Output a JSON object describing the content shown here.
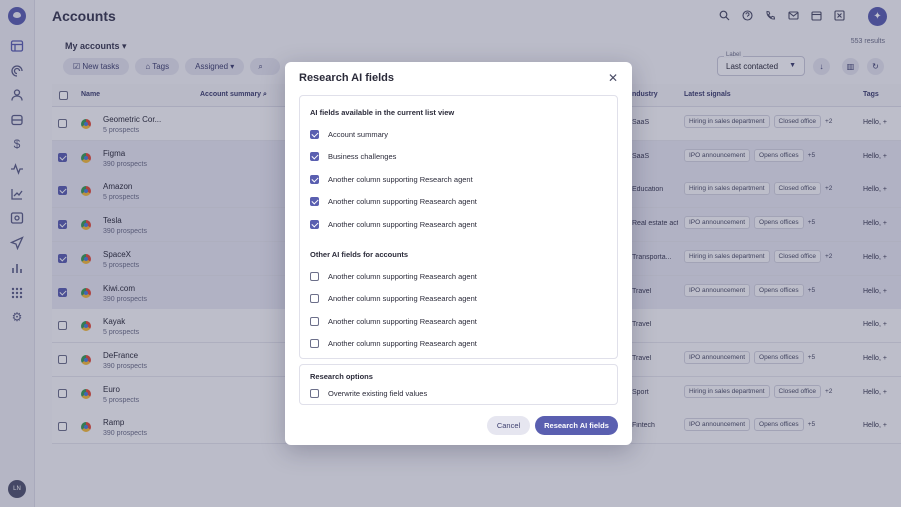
{
  "app": {
    "title": "Accounts",
    "avatar_initials": "LN",
    "results": "553 results"
  },
  "list": {
    "title": "My accounts"
  },
  "toolbar": {
    "new_tasks": "New tasks",
    "tags": "Tags",
    "assigned": "Assigned"
  },
  "label_filter": {
    "legend": "Label",
    "value": "Last contacted"
  },
  "table": {
    "headers": {
      "name": "Name",
      "account_summary": "Account summary",
      "industry": "Industry",
      "latest_signals": "Latest signals",
      "tags": "Tags"
    },
    "rows": [
      {
        "name": "Geometric Cor...",
        "prospects": "5 prospects",
        "selected": false,
        "industry": "SaaS",
        "signals": [
          "Hiring in sales department",
          "Closed office"
        ],
        "more": "+2",
        "tags": "Hello, +"
      },
      {
        "name": "Figma",
        "prospects": "390 prospects",
        "selected": true,
        "industry": "SaaS",
        "signals": [
          "IPO announcement",
          "Opens offices"
        ],
        "more": "+5",
        "tags": "Hello, +"
      },
      {
        "name": "Amazon",
        "prospects": "5 prospects",
        "selected": true,
        "industry": "Education",
        "signals": [
          "Hiring in sales department",
          "Closed office"
        ],
        "more": "+2",
        "tags": "Hello, +"
      },
      {
        "name": "Tesla",
        "prospects": "390 prospects",
        "selected": true,
        "industry": "Real estate activities",
        "signals": [
          "IPO announcement",
          "Opens offices"
        ],
        "more": "+5",
        "tags": "Hello, +"
      },
      {
        "name": "SpaceX",
        "prospects": "5 prospects",
        "selected": true,
        "industry": "Transporta...",
        "signals": [
          "Hiring in sales department",
          "Closed office"
        ],
        "more": "+2",
        "tags": "Hello, +"
      },
      {
        "name": "Kiwi.com",
        "prospects": "390 prospects",
        "selected": true,
        "industry": "Travel",
        "signals": [
          "IPO announcement",
          "Opens offices"
        ],
        "more": "+5",
        "tags": "Hello, +"
      },
      {
        "name": "Kayak",
        "prospects": "5 prospects",
        "selected": false,
        "industry": "Travel",
        "signals": [],
        "more": "",
        "tags": "Hello, +"
      },
      {
        "name": "DeFrance",
        "prospects": "390 prospects",
        "selected": false,
        "industry": "Travel",
        "signals": [
          "IPO announcement",
          "Opens offices"
        ],
        "more": "+5",
        "tags": "Hello, +"
      },
      {
        "name": "Euro",
        "prospects": "5 prospects",
        "selected": false,
        "industry": "Sport",
        "signals": [
          "Hiring in sales department",
          "Closed office"
        ],
        "more": "+2",
        "tags": "Hello, +"
      },
      {
        "name": "Ramp",
        "prospects": "390 prospects",
        "selected": false,
        "industry": "Fintech",
        "signals": [
          "IPO announcement",
          "Opens offices"
        ],
        "more": "+5",
        "tags": "Hello, +"
      }
    ]
  },
  "modal": {
    "title": "Research AI fields",
    "section_current": "AI fields available in the current list view",
    "current_fields": [
      {
        "label": "Account summary",
        "checked": true
      },
      {
        "label": "Business challenges",
        "checked": true
      },
      {
        "label": "Another column supporting Research agent",
        "checked": true
      },
      {
        "label": "Another column supporting Reasearch agent",
        "checked": true
      },
      {
        "label": "Another column supporting Reasearch agent",
        "checked": true
      }
    ],
    "section_other": "Other AI fields for accounts",
    "other_fields": [
      {
        "label": "Another column supporting Reasearch agent",
        "checked": false
      },
      {
        "label": "Another column supporting Reasearch agent",
        "checked": false
      },
      {
        "label": "Another column supporting Reasearch agent",
        "checked": false
      },
      {
        "label": "Another column supporting Reasearch agent",
        "checked": false
      }
    ],
    "section_options": "Research options",
    "overwrite_label": "Overwrite existing field values",
    "overwrite_checked": false,
    "cancel_label": "Cancel",
    "submit_label": "Research AI fields"
  }
}
